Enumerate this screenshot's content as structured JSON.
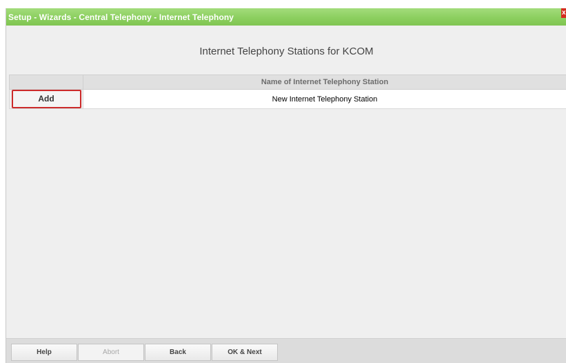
{
  "window": {
    "title": "Setup - Wizards - Central Telephony - Internet Telephony",
    "close_glyph": "x"
  },
  "heading": "Internet Telephony Stations for KCOM",
  "table": {
    "columns": [
      "",
      "Name of Internet Telephony Station"
    ],
    "rows": [
      {
        "action_label": "Add",
        "name": "New Internet Telephony Station"
      }
    ]
  },
  "footer": {
    "buttons": [
      {
        "label": "Help",
        "enabled": true
      },
      {
        "label": "Abort",
        "enabled": false
      },
      {
        "label": "Back",
        "enabled": true
      },
      {
        "label": "OK & Next",
        "enabled": true
      }
    ]
  },
  "colors": {
    "titlebar_green": "#8ccf5f",
    "close_red": "#d42c1f",
    "highlight_red": "#cc2a2a",
    "background_gray": "#efefef"
  },
  "icons": {
    "close": "close-icon"
  }
}
